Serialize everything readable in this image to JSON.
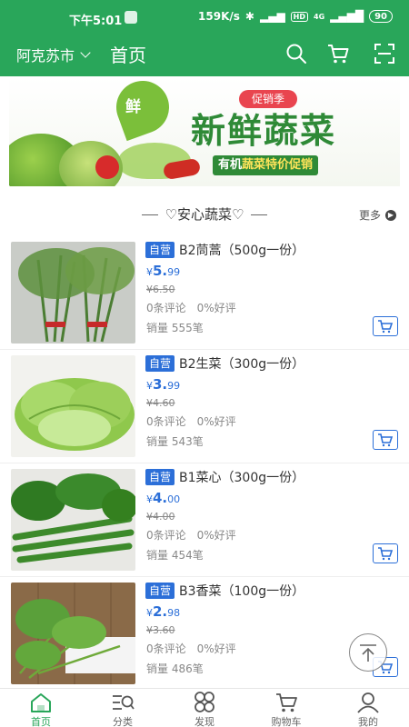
{
  "status_bar": {
    "time": "下午5:01",
    "network_speed": "159K/s",
    "hd": "HD",
    "signal": "4G",
    "battery": "90"
  },
  "header": {
    "city": "阿克苏市",
    "title": "首页"
  },
  "banner": {
    "leaf_text": "鲜",
    "promo": "促销季",
    "title": "新鲜蔬菜",
    "subtitle_a": "有机",
    "subtitle_b": "蔬菜",
    "subtitle_c": "特价促销"
  },
  "section": {
    "title": "♡安心蔬菜♡",
    "more": "更多"
  },
  "products": [
    {
      "tag": "自营",
      "name": "B2茼蒿（500g一份）",
      "price_symbol": "¥",
      "price_int": "5.",
      "price_dec": "99",
      "old_price": "¥6.50",
      "comments": "0条评论",
      "rating": "0%好评",
      "sales": "销量 555笔"
    },
    {
      "tag": "自营",
      "name": "B2生菜（300g一份）",
      "price_symbol": "¥",
      "price_int": "3.",
      "price_dec": "99",
      "old_price": "¥4.60",
      "comments": "0条评论",
      "rating": "0%好评",
      "sales": "销量 543笔"
    },
    {
      "tag": "自营",
      "name": "B1菜心（300g一份）",
      "price_symbol": "¥",
      "price_int": "4.",
      "price_dec": "00",
      "old_price": "¥4.00",
      "comments": "0条评论",
      "rating": "0%好评",
      "sales": "销量 454笔"
    },
    {
      "tag": "自营",
      "name": "B3香菜（100g一份）",
      "price_symbol": "¥",
      "price_int": "2.",
      "price_dec": "98",
      "old_price": "¥3.60",
      "comments": "0条评论",
      "rating": "0%好评",
      "sales": "销量 486笔"
    }
  ],
  "tabs": [
    {
      "label": "首页",
      "icon": "home-icon",
      "active": true
    },
    {
      "label": "分类",
      "icon": "category-icon",
      "active": false
    },
    {
      "label": "发现",
      "icon": "discover-icon",
      "active": false
    },
    {
      "label": "购物车",
      "icon": "cart-icon",
      "active": false
    },
    {
      "label": "我的",
      "icon": "profile-icon",
      "active": false
    }
  ],
  "colors": {
    "brand_green": "#29a65a",
    "accent_blue": "#2c6fd8",
    "promo_red": "#e9454f"
  }
}
